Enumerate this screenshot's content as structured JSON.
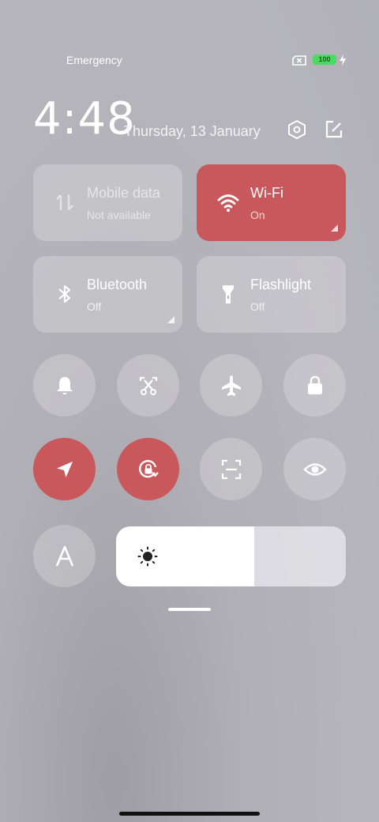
{
  "status_bar": {
    "carrier": "Emergency",
    "battery_level": "100",
    "icons": [
      "no-sim-icon",
      "battery-icon",
      "charging-bolt-icon"
    ]
  },
  "header": {
    "time": "4:48",
    "date": "Thursday, 13 January",
    "icons": [
      "settings-hexagon-icon",
      "edit-icon"
    ]
  },
  "tiles": [
    {
      "name": "Mobile data",
      "status": "Not available",
      "icon": "mobile-data-icon",
      "state": "unavailable"
    },
    {
      "name": "Wi-Fi",
      "status": "On",
      "icon": "wifi-icon",
      "state": "on"
    },
    {
      "name": "Bluetooth",
      "status": "Off",
      "icon": "bluetooth-icon",
      "state": "off"
    },
    {
      "name": "Flashlight",
      "status": "Off",
      "icon": "flashlight-icon",
      "state": "off"
    }
  ],
  "toggles": [
    {
      "icon": "bell-icon",
      "state": "off"
    },
    {
      "icon": "screenshot-icon",
      "state": "off"
    },
    {
      "icon": "airplane-icon",
      "state": "off"
    },
    {
      "icon": "lock-icon",
      "state": "off"
    },
    {
      "icon": "location-icon",
      "state": "on"
    },
    {
      "icon": "rotation-lock-icon",
      "state": "on"
    },
    {
      "icon": "scanner-icon",
      "state": "off"
    },
    {
      "icon": "reading-mode-eye-icon",
      "state": "off"
    },
    {
      "icon": "font-icon",
      "state": "off"
    }
  ],
  "brightness": {
    "level_percent": 60,
    "icon": "sun-icon"
  },
  "colors": {
    "accent": "#c8585b",
    "battery": "#4cd964"
  }
}
